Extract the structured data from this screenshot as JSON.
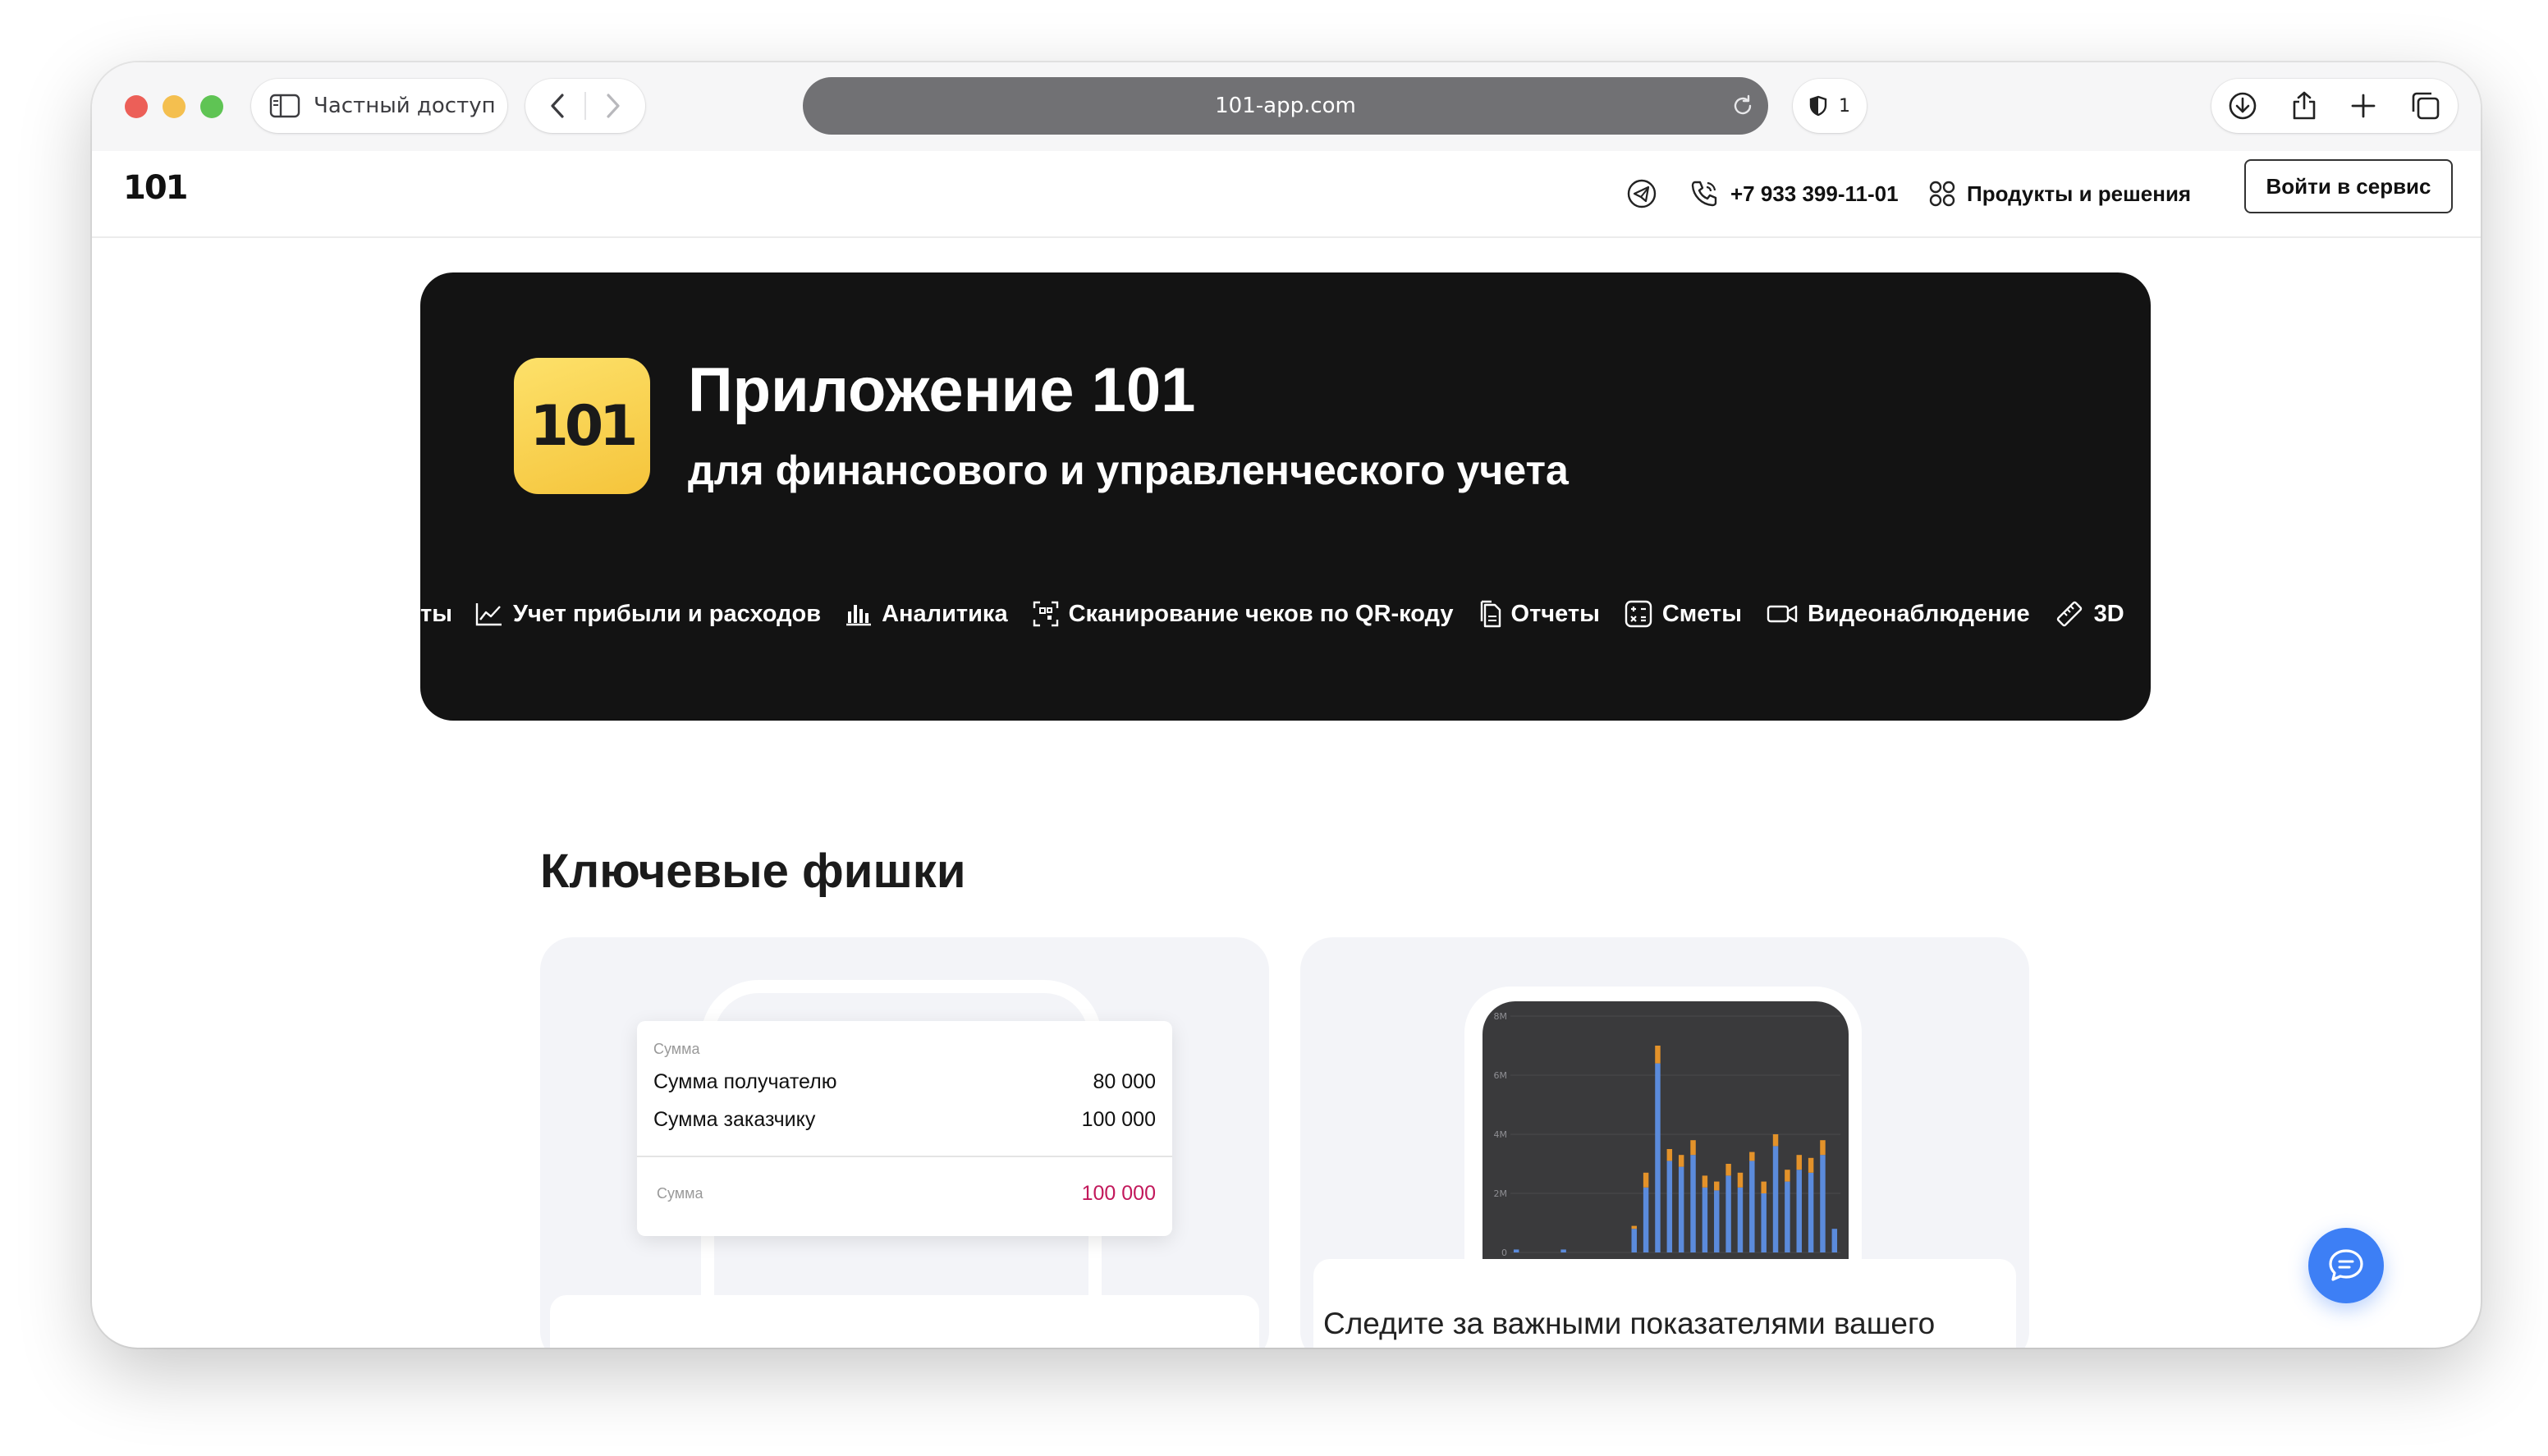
{
  "browser": {
    "private_label": "Частный доступ",
    "url": "101-app.com",
    "privacy_count": "1"
  },
  "header": {
    "logo": "101",
    "phone": "+7 933 399-11-01",
    "products": "Продукты и решения",
    "login": "Войти в сервис"
  },
  "hero": {
    "icon_text": "101",
    "title": "Приложение 101",
    "subtitle": "для финансового и управленческого учета",
    "features": [
      {
        "label": "ты",
        "icon": "none"
      },
      {
        "label": "Учет прибыли и расходов",
        "icon": "line-chart-icon"
      },
      {
        "label": "Аналитика",
        "icon": "bar-chart-icon"
      },
      {
        "label": "Сканирование чеков по QR-коду",
        "icon": "qr-scan-icon"
      },
      {
        "label": "Отчеты",
        "icon": "document-icon"
      },
      {
        "label": "Сметы",
        "icon": "calculator-icon"
      },
      {
        "label": "Видеонаблюдение",
        "icon": "video-camera-icon"
      },
      {
        "label": "3D",
        "icon": "ruler-icon"
      }
    ]
  },
  "section": {
    "title": "Ключевые фишки"
  },
  "card1": {
    "top_label": "Сумма",
    "row1_label": "Сумма получателю",
    "row1_value": "80 000",
    "row2_label": "Сумма заказчику",
    "row2_value": "100 000",
    "bottom_label": "Сумма",
    "bottom_value": "100 000",
    "accent": "#c2185b"
  },
  "card2": {
    "text": "Следите за важными показателями вашего",
    "chart_ticks": [
      "8M",
      "6M",
      "4M",
      "2M",
      "0"
    ]
  },
  "chart_data": {
    "type": "bar",
    "title": "",
    "xlabel": "",
    "ylabel": "",
    "ylim": [
      0,
      8
    ],
    "y_ticks": [
      "8M",
      "6M",
      "4M",
      "2M",
      "0"
    ],
    "series": [
      {
        "values": [
          0.1,
          0,
          0,
          0,
          0.1,
          0,
          0,
          0,
          0,
          0,
          0.8,
          2.2,
          6.4,
          3.1,
          2.9,
          3.3,
          2.2,
          2.1,
          2.6,
          2.2,
          3.1,
          2.0,
          3.6,
          2.4,
          2.8,
          2.7,
          3.3,
          0.8
        ]
      },
      {
        "values": [
          0,
          0,
          0,
          0,
          0,
          0,
          0,
          0,
          0,
          0,
          0.1,
          0.5,
          0.6,
          0.4,
          0.4,
          0.5,
          0.4,
          0.3,
          0.4,
          0.5,
          0.3,
          0.4,
          0.4,
          0.4,
          0.5,
          0.5,
          0.5,
          0
        ]
      }
    ],
    "colors": [
      "#5b8bdc",
      "#e3922a"
    ]
  }
}
